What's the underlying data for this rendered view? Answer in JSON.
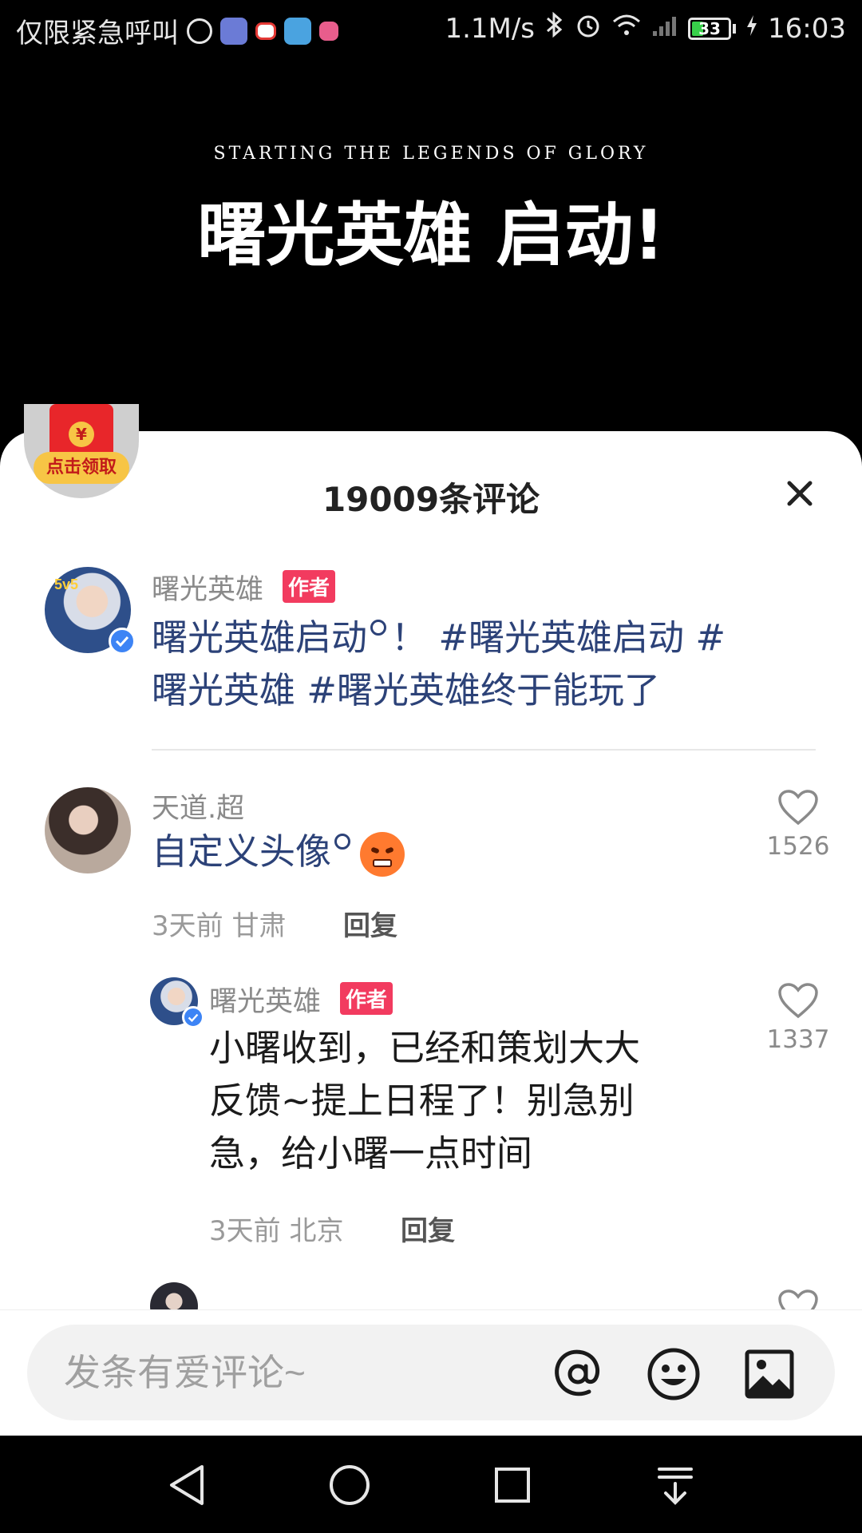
{
  "status_bar": {
    "carrier_text": "仅限紧急呼叫",
    "speed": "1.1M/s",
    "battery": "33",
    "time": "16:03"
  },
  "video": {
    "subtitle": "STARTING THE LEGENDS OF GLORY",
    "title": "曙光英雄 启动!"
  },
  "red_packet": {
    "label": "点击领取"
  },
  "panel": {
    "title": "19009条评论"
  },
  "pinned": {
    "name": "曙光英雄",
    "tag": "作者",
    "text_part1": "曙光英雄启动",
    "text_part2": "！",
    "text_line1_tags": "#曙光英雄启动 #",
    "text_line2": "曙光英雄 #曙光英雄终于能玩了"
  },
  "comments": [
    {
      "name": "天道.超",
      "text": "自定义头像",
      "time": "3天前",
      "location": "甘肃",
      "reply_label": "回复",
      "likes": "1526"
    }
  ],
  "reply": {
    "name": "曙光英雄",
    "tag": "作者",
    "line1": "小曙收到，已经和策划大大",
    "line2": "反馈~提上日程了！别急别",
    "line3": "急，给小曙一点时间",
    "time": "3天前",
    "location": "北京",
    "reply_label": "回复",
    "likes": "1337"
  },
  "input": {
    "placeholder": "发条有爱评论~"
  },
  "colors": {
    "accent_tag": "#f23b5f",
    "link": "#2c4278",
    "verified": "#3d84f5"
  }
}
